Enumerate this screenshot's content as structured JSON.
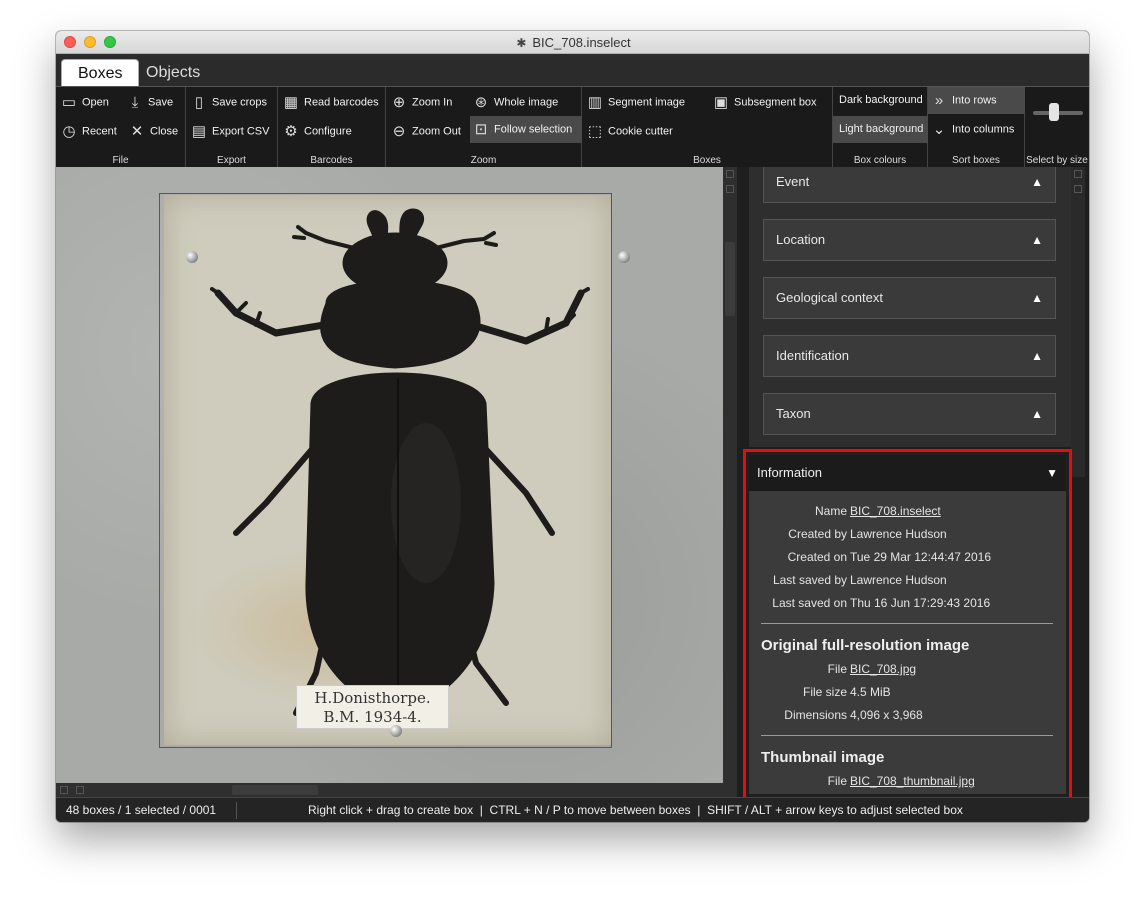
{
  "window": {
    "title": "BIC_708.inselect"
  },
  "tabs": [
    {
      "label": "Boxes"
    },
    {
      "label": "Objects"
    }
  ],
  "ribbon": {
    "file": {
      "open": "Open",
      "save": "Save",
      "recent": "Recent",
      "close": "Close",
      "label": "File"
    },
    "export": {
      "save_crops": "Save crops",
      "export_csv": "Export CSV",
      "label": "Export"
    },
    "barcodes": {
      "read": "Read barcodes",
      "configure": "Configure",
      "label": "Barcodes"
    },
    "zoom": {
      "zoom_in": "Zoom In",
      "zoom_out": "Zoom Out",
      "whole_image": "Whole image",
      "follow_selection": "Follow selection",
      "label": "Zoom"
    },
    "boxes": {
      "segment_image": "Segment image",
      "subsegment_box": "Subsegment box",
      "cookie_cutter": "Cookie cutter",
      "label": "Boxes"
    },
    "box_colours": {
      "dark": "Dark background",
      "light": "Light background",
      "label": "Box colours"
    },
    "sort_boxes": {
      "rows": "Into rows",
      "columns": "Into columns",
      "label": "Sort boxes"
    },
    "select_by_size": {
      "label": "Select by size"
    }
  },
  "specimen_label": {
    "line1": "H.Donisthorpe.",
    "line2": "B.M. 1934-4."
  },
  "metadata_sections": [
    {
      "label": "Event"
    },
    {
      "label": "Location"
    },
    {
      "label": "Geological context"
    },
    {
      "label": "Identification"
    },
    {
      "label": "Taxon"
    }
  ],
  "information": {
    "title": "Information",
    "name_k": "Name",
    "name_v": "BIC_708.inselect",
    "created_by_k": "Created by",
    "created_by_v": "Lawrence Hudson",
    "created_on_k": "Created on",
    "created_on_v": "Tue 29 Mar 12:44:47 2016",
    "last_saved_by_k": "Last saved by",
    "last_saved_by_v": "Lawrence Hudson",
    "last_saved_on_k": "Last saved on",
    "last_saved_on_v": "Thu 16 Jun 17:29:43 2016",
    "original_heading": "Original full-resolution image",
    "file_k": "File",
    "file_v": "BIC_708.jpg",
    "file_size_k": "File size",
    "file_size_v": "4.5 MiB",
    "dimensions_k": "Dimensions",
    "dimensions_v": "4,096 x 3,968",
    "thumb_heading": "Thumbnail image",
    "thumb_file_k": "File",
    "thumb_file_v": "BIC_708_thumbnail.jpg"
  },
  "status": {
    "summary": "48 boxes / 1 selected / 0001",
    "hint": "Right click + drag to create box  |  CTRL + N / P to move between boxes  |  SHIFT / ALT + arrow keys to adjust selected box"
  },
  "colors": {
    "selection": "#e21d1d",
    "highlight": "#e30e0e"
  }
}
